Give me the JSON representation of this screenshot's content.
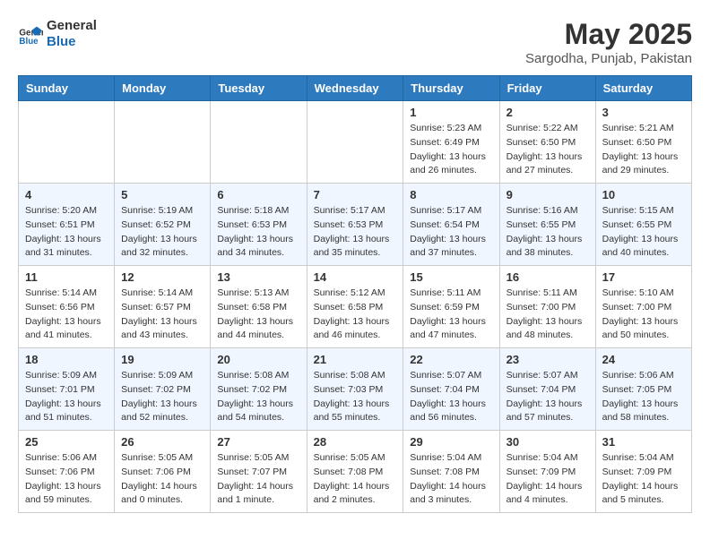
{
  "header": {
    "logo_line1": "General",
    "logo_line2": "Blue",
    "month_year": "May 2025",
    "location": "Sargodha, Punjab, Pakistan"
  },
  "weekdays": [
    "Sunday",
    "Monday",
    "Tuesday",
    "Wednesday",
    "Thursday",
    "Friday",
    "Saturday"
  ],
  "weeks": [
    [
      {
        "day": "",
        "info": ""
      },
      {
        "day": "",
        "info": ""
      },
      {
        "day": "",
        "info": ""
      },
      {
        "day": "",
        "info": ""
      },
      {
        "day": "1",
        "info": "Sunrise: 5:23 AM\nSunset: 6:49 PM\nDaylight: 13 hours\nand 26 minutes."
      },
      {
        "day": "2",
        "info": "Sunrise: 5:22 AM\nSunset: 6:50 PM\nDaylight: 13 hours\nand 27 minutes."
      },
      {
        "day": "3",
        "info": "Sunrise: 5:21 AM\nSunset: 6:50 PM\nDaylight: 13 hours\nand 29 minutes."
      }
    ],
    [
      {
        "day": "4",
        "info": "Sunrise: 5:20 AM\nSunset: 6:51 PM\nDaylight: 13 hours\nand 31 minutes."
      },
      {
        "day": "5",
        "info": "Sunrise: 5:19 AM\nSunset: 6:52 PM\nDaylight: 13 hours\nand 32 minutes."
      },
      {
        "day": "6",
        "info": "Sunrise: 5:18 AM\nSunset: 6:53 PM\nDaylight: 13 hours\nand 34 minutes."
      },
      {
        "day": "7",
        "info": "Sunrise: 5:17 AM\nSunset: 6:53 PM\nDaylight: 13 hours\nand 35 minutes."
      },
      {
        "day": "8",
        "info": "Sunrise: 5:17 AM\nSunset: 6:54 PM\nDaylight: 13 hours\nand 37 minutes."
      },
      {
        "day": "9",
        "info": "Sunrise: 5:16 AM\nSunset: 6:55 PM\nDaylight: 13 hours\nand 38 minutes."
      },
      {
        "day": "10",
        "info": "Sunrise: 5:15 AM\nSunset: 6:55 PM\nDaylight: 13 hours\nand 40 minutes."
      }
    ],
    [
      {
        "day": "11",
        "info": "Sunrise: 5:14 AM\nSunset: 6:56 PM\nDaylight: 13 hours\nand 41 minutes."
      },
      {
        "day": "12",
        "info": "Sunrise: 5:14 AM\nSunset: 6:57 PM\nDaylight: 13 hours\nand 43 minutes."
      },
      {
        "day": "13",
        "info": "Sunrise: 5:13 AM\nSunset: 6:58 PM\nDaylight: 13 hours\nand 44 minutes."
      },
      {
        "day": "14",
        "info": "Sunrise: 5:12 AM\nSunset: 6:58 PM\nDaylight: 13 hours\nand 46 minutes."
      },
      {
        "day": "15",
        "info": "Sunrise: 5:11 AM\nSunset: 6:59 PM\nDaylight: 13 hours\nand 47 minutes."
      },
      {
        "day": "16",
        "info": "Sunrise: 5:11 AM\nSunset: 7:00 PM\nDaylight: 13 hours\nand 48 minutes."
      },
      {
        "day": "17",
        "info": "Sunrise: 5:10 AM\nSunset: 7:00 PM\nDaylight: 13 hours\nand 50 minutes."
      }
    ],
    [
      {
        "day": "18",
        "info": "Sunrise: 5:09 AM\nSunset: 7:01 PM\nDaylight: 13 hours\nand 51 minutes."
      },
      {
        "day": "19",
        "info": "Sunrise: 5:09 AM\nSunset: 7:02 PM\nDaylight: 13 hours\nand 52 minutes."
      },
      {
        "day": "20",
        "info": "Sunrise: 5:08 AM\nSunset: 7:02 PM\nDaylight: 13 hours\nand 54 minutes."
      },
      {
        "day": "21",
        "info": "Sunrise: 5:08 AM\nSunset: 7:03 PM\nDaylight: 13 hours\nand 55 minutes."
      },
      {
        "day": "22",
        "info": "Sunrise: 5:07 AM\nSunset: 7:04 PM\nDaylight: 13 hours\nand 56 minutes."
      },
      {
        "day": "23",
        "info": "Sunrise: 5:07 AM\nSunset: 7:04 PM\nDaylight: 13 hours\nand 57 minutes."
      },
      {
        "day": "24",
        "info": "Sunrise: 5:06 AM\nSunset: 7:05 PM\nDaylight: 13 hours\nand 58 minutes."
      }
    ],
    [
      {
        "day": "25",
        "info": "Sunrise: 5:06 AM\nSunset: 7:06 PM\nDaylight: 13 hours\nand 59 minutes."
      },
      {
        "day": "26",
        "info": "Sunrise: 5:05 AM\nSunset: 7:06 PM\nDaylight: 14 hours\nand 0 minutes."
      },
      {
        "day": "27",
        "info": "Sunrise: 5:05 AM\nSunset: 7:07 PM\nDaylight: 14 hours\nand 1 minute."
      },
      {
        "day": "28",
        "info": "Sunrise: 5:05 AM\nSunset: 7:08 PM\nDaylight: 14 hours\nand 2 minutes."
      },
      {
        "day": "29",
        "info": "Sunrise: 5:04 AM\nSunset: 7:08 PM\nDaylight: 14 hours\nand 3 minutes."
      },
      {
        "day": "30",
        "info": "Sunrise: 5:04 AM\nSunset: 7:09 PM\nDaylight: 14 hours\nand 4 minutes."
      },
      {
        "day": "31",
        "info": "Sunrise: 5:04 AM\nSunset: 7:09 PM\nDaylight: 14 hours\nand 5 minutes."
      }
    ]
  ]
}
